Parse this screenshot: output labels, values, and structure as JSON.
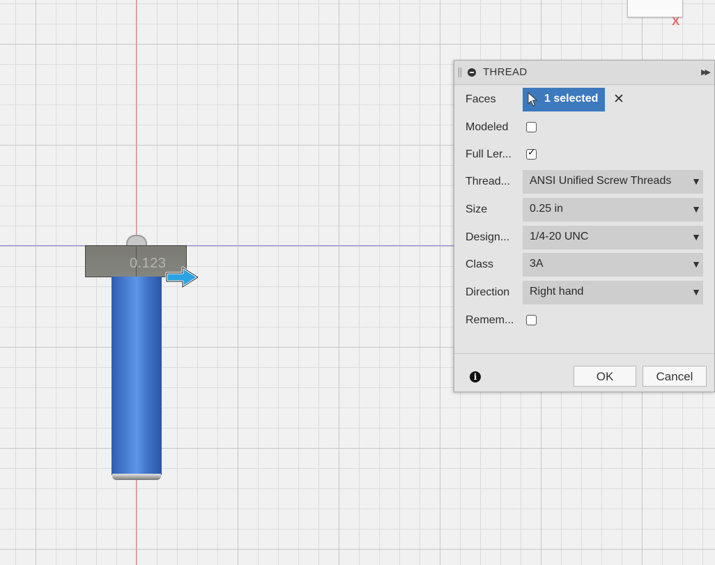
{
  "canvas": {
    "dimension_value": "0.123"
  },
  "dialog": {
    "title": "THREAD",
    "faces": {
      "label": "Faces",
      "selection_text": "1 selected",
      "clear_symbol": "✕"
    },
    "modeled": {
      "label": "Modeled",
      "checked": false
    },
    "full_length": {
      "label": "Full Ler...",
      "checked": true
    },
    "thread_type": {
      "label": "Thread...",
      "value": "ANSI Unified Screw Threads"
    },
    "size": {
      "label": "Size",
      "value": "0.25 in"
    },
    "designation": {
      "label": "Design...",
      "value": "1/4-20 UNC"
    },
    "class": {
      "label": "Class",
      "value": "3A"
    },
    "direction": {
      "label": "Direction",
      "value": "Right hand"
    },
    "remember": {
      "label": "Remem...",
      "checked": false
    },
    "ok_label": "OK",
    "cancel_label": "Cancel"
  },
  "icons": {
    "collapse": "collapse-icon",
    "expand": "expand-icon",
    "cursor": "cursor-icon",
    "info": "info-icon",
    "dropdown_arrow": "chevron-down-icon",
    "manipulator": "arrow-right-icon"
  },
  "colors": {
    "selection_blue": "#3d79bd",
    "rod_blue": "#4a7fd5",
    "manipulator_blue": "#2ba3e0",
    "x_axis": "#e08a8a",
    "y_axis": "#8a8ae6"
  }
}
